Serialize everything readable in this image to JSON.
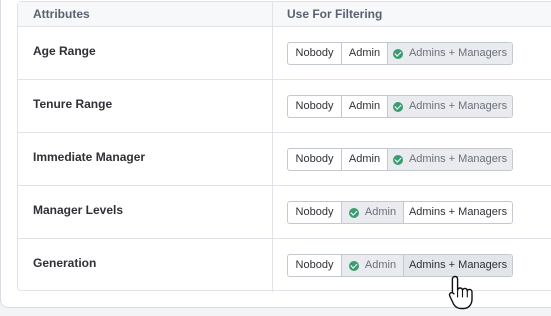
{
  "table": {
    "headers": {
      "attributes": "Attributes",
      "filtering": "Use For Filtering"
    },
    "rows": [
      {
        "label": "Age Range",
        "options": [
          "Nobody",
          "Admin",
          "Admins + Managers"
        ],
        "selected": "Admins + Managers"
      },
      {
        "label": "Tenure Range",
        "options": [
          "Nobody",
          "Admin",
          "Admins + Managers"
        ],
        "selected": "Admins + Managers"
      },
      {
        "label": "Immediate Manager",
        "options": [
          "Nobody",
          "Admin",
          "Admins + Managers"
        ],
        "selected": "Admins + Managers"
      },
      {
        "label": "Manager Levels",
        "options": [
          "Nobody",
          "Admin",
          "Admins + Managers"
        ],
        "selected": "Admin"
      },
      {
        "label": "Generation",
        "options": [
          "Nobody",
          "Admin",
          "Admins + Managers"
        ],
        "selected": "Admin"
      }
    ]
  },
  "colors": {
    "check": "#3a9d72",
    "selected_bg": "#e9ebee",
    "border": "#c4c8cf"
  },
  "icons": {
    "selected": "check-circle-icon",
    "cursor": "hand-pointer-cursor-icon"
  }
}
